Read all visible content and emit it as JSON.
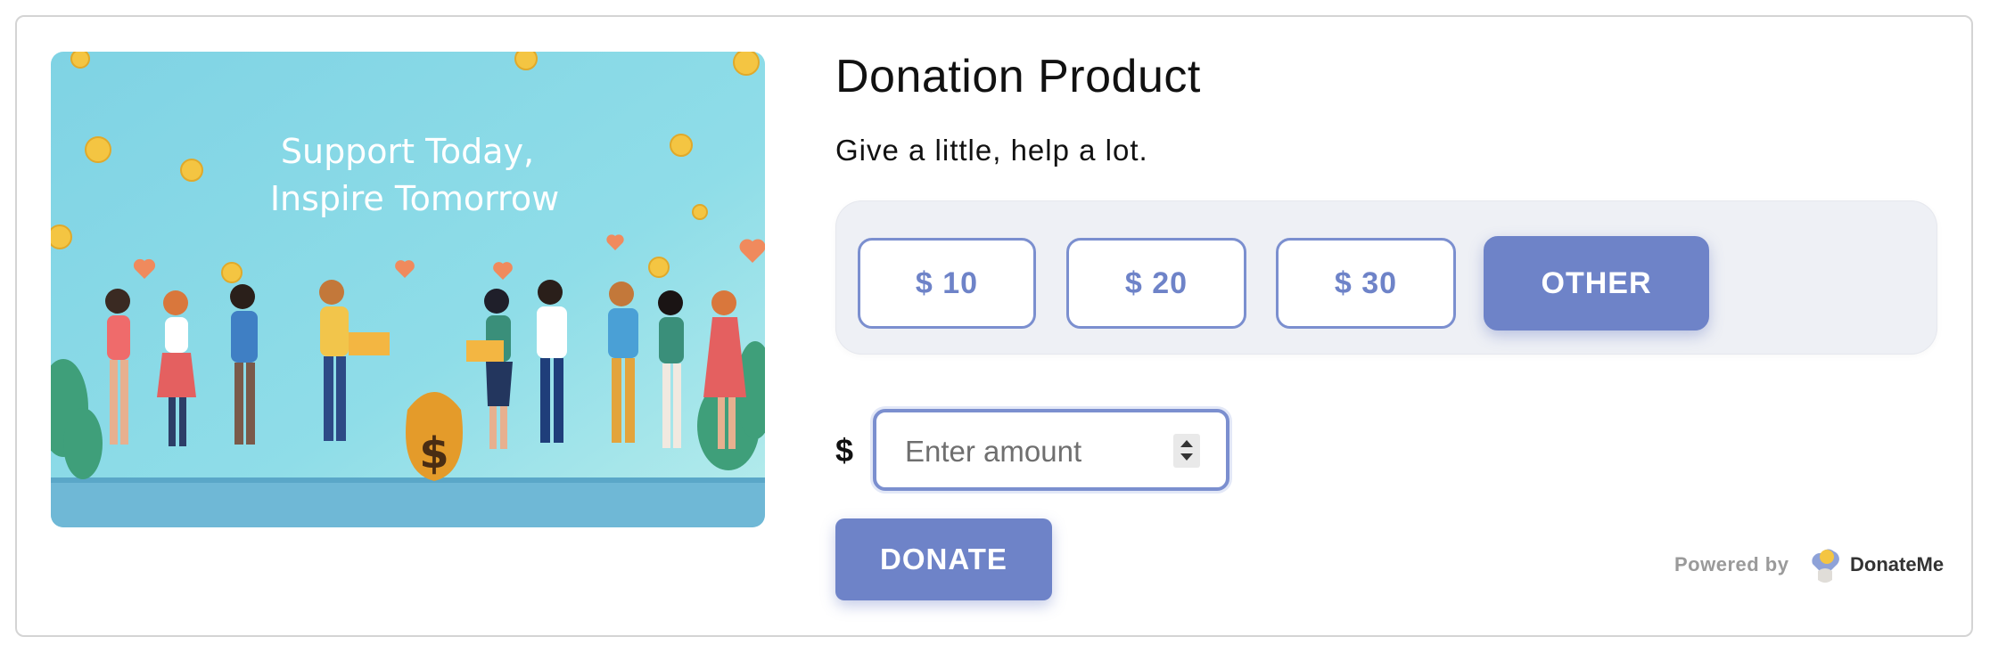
{
  "hero": {
    "headline_line1": "Support Today,",
    "headline_line2": "Inspire Tomorrow",
    "bag_symbol": "$"
  },
  "product": {
    "title": "Donation Product",
    "subtitle": "Give a little, help a lot."
  },
  "amounts": [
    {
      "label": "$ 10",
      "selected": false
    },
    {
      "label": "$ 20",
      "selected": false
    },
    {
      "label": "$ 30",
      "selected": false
    },
    {
      "label": "OTHER",
      "selected": true
    }
  ],
  "custom_amount": {
    "currency_symbol": "$",
    "placeholder": "Enter amount",
    "value": ""
  },
  "donate_button": "DONATE",
  "footer": {
    "powered_by": "Powered by",
    "brand": "DonateMe",
    "brand_icon": "heart-coin-icon"
  },
  "colors": {
    "accent": "#6e83c8",
    "panel_bg": "#eef0f5",
    "border": "#7b8fcf"
  }
}
